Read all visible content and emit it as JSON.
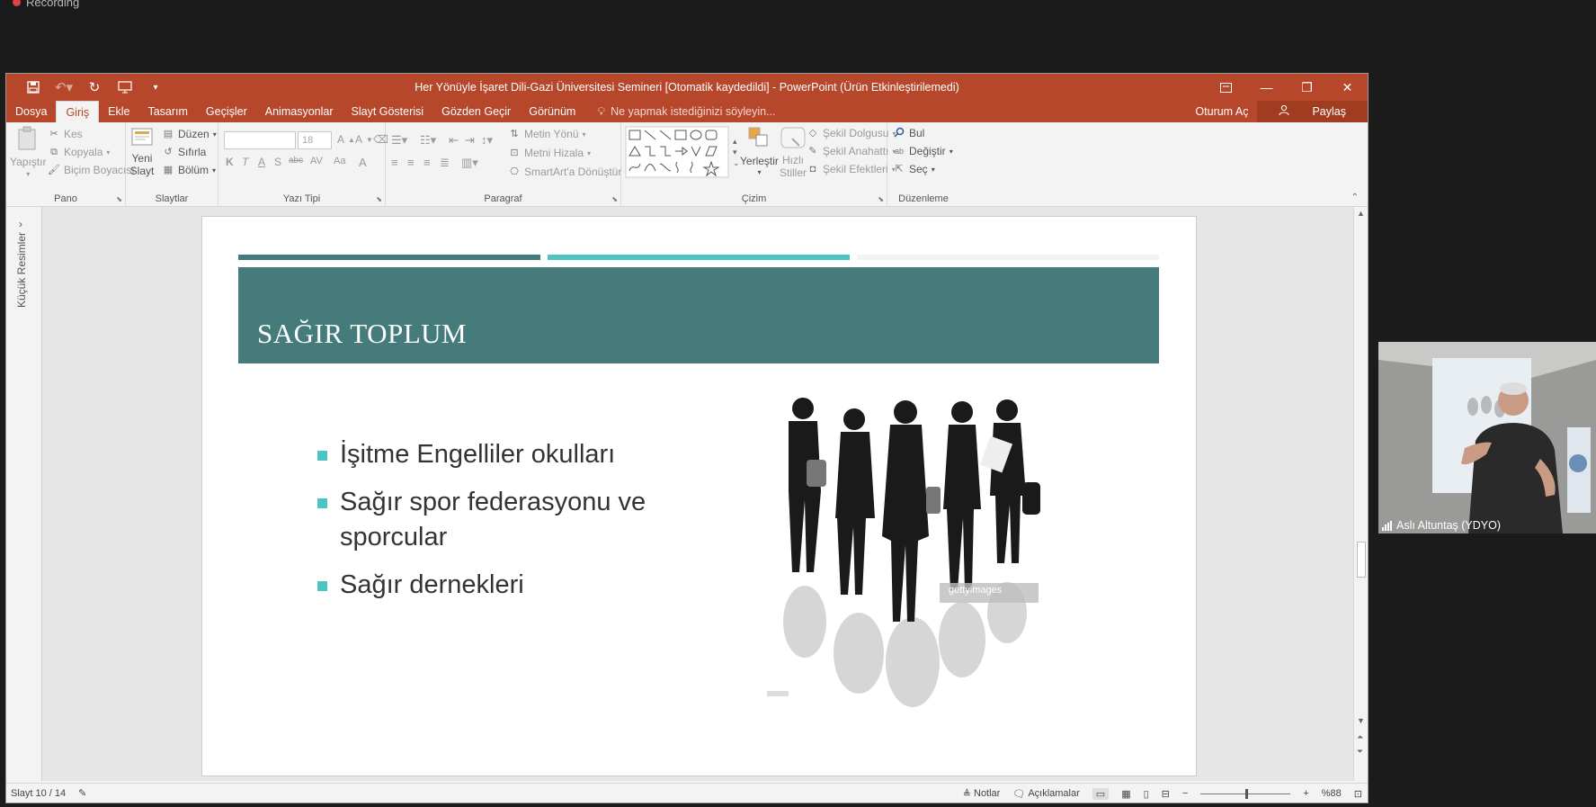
{
  "recording": {
    "label": "Recording",
    "color": "#dd4444"
  },
  "window": {
    "title": "Her Yönüyle İşaret Dili-Gazi Üniversitesi Semineri [Otomatik kaydedildi]  -  PowerPoint (Ürün Etkinleştirilemedi)",
    "accent": "#b7472a"
  },
  "qat": {
    "save_icon": "save-icon",
    "undo_icon": "undo-icon",
    "redo_icon": "redo-icon",
    "present_icon": "present-from-start-icon",
    "customize_icon": "customize-qat-icon"
  },
  "tabs": [
    "Dosya",
    "Giriş",
    "Ekle",
    "Tasarım",
    "Geçişler",
    "Animasyonlar",
    "Slayt Gösterisi",
    "Gözden Geçir",
    "Görünüm"
  ],
  "active_tab": "Giriş",
  "tell_me": "Ne yapmak istediğinizi söyleyin...",
  "account": {
    "signin": "Oturum Aç",
    "share": "Paylaş"
  },
  "ribbon": {
    "pano": {
      "label": "Pano",
      "paste": "Yapıştır",
      "cut": "Kes",
      "copy": "Kopyala",
      "format_painter": "Biçim Boyacısı"
    },
    "slaytlar": {
      "label": "Slaytlar",
      "new_slide_1": "Yeni",
      "new_slide_2": "Slayt",
      "layout": "Düzen",
      "reset": "Sıfırla",
      "section": "Bölüm"
    },
    "yazi_tipi": {
      "label": "Yazı Tipi",
      "font_name": "",
      "font_size": "18",
      "bold": "K",
      "italic": "T",
      "underline": "A",
      "shadow": "S",
      "strike": "abc",
      "spacing": "AV",
      "case": "Aa",
      "color": "A",
      "grow": "A",
      "shrink": "A"
    },
    "paragraf": {
      "label": "Paragraf",
      "text_direction": "Metin Yönü",
      "align_text": "Metni Hizala",
      "smartart": "SmartArt'a Dönüştür"
    },
    "cizim": {
      "label": "Çizim",
      "arrange": "Yerleştir",
      "quick_styles_1": "Hızlı",
      "quick_styles_2": "Stiller",
      "fill": "Şekil Dolgusu",
      "outline": "Şekil Anahattı",
      "effects": "Şekil Efektleri"
    },
    "duzenleme": {
      "label": "Düzenleme",
      "find": "Bul",
      "replace": "Değiştir",
      "select": "Seç"
    }
  },
  "thumbnails_label": "Küçük Resimler",
  "slide": {
    "title": "SAĞIR TOPLUM",
    "bullets": [
      "İşitme Engelliler okulları",
      "Sağır spor federasyonu ve sporcular",
      "Sağır dernekleri"
    ],
    "watermark": "gettyimages",
    "colors": {
      "dark_teal": "#457c7b",
      "light_teal": "#4dc3c2"
    }
  },
  "status": {
    "slide_count": "Slayt 10 / 14",
    "notes": "Notlar",
    "comments": "Açıklamalar",
    "zoom": "%88"
  },
  "video": {
    "participant": "Aslı Altuntaş (YDYO)"
  }
}
